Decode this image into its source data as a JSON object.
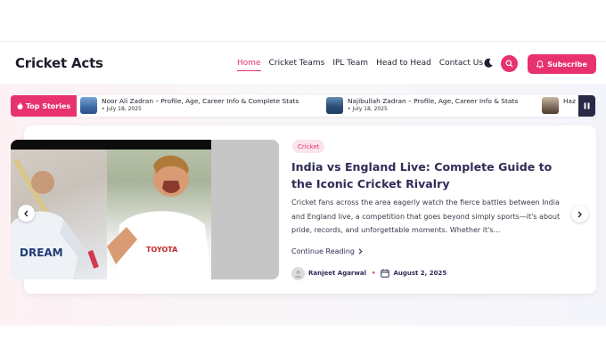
{
  "site": {
    "logo": "Cricket Acts"
  },
  "nav": {
    "items": [
      {
        "label": "Home",
        "active": true
      },
      {
        "label": "Cricket Teams",
        "active": false
      },
      {
        "label": "IPL Team",
        "active": false
      },
      {
        "label": "Head to Head",
        "active": false
      },
      {
        "label": "Contact Us",
        "active": false
      }
    ]
  },
  "header": {
    "theme_icon": "moon-icon",
    "search_icon": "search-icon",
    "subscribe_label": "Subscribe",
    "subscribe_icon": "bell-icon"
  },
  "ticker": {
    "label": "Top Stories",
    "label_icon": "flame-icon",
    "items": [
      {
        "title": "Noor Ali Zadran – Profile, Age, Career Info & Complete Stats",
        "date": "July 18, 2025"
      },
      {
        "title": "Najibullah Zadran – Profile, Age, Career Info & Stats",
        "date": "July 18, 2025"
      },
      {
        "title": "Haz",
        "date": ""
      }
    ],
    "pause_icon": "pause-icon"
  },
  "featured": {
    "category": "Cricket",
    "title": "India vs England Live: Complete Guide to the Iconic Cricket Rivalry",
    "excerpt": "Cricket fans across the area eagerly watch the fierce battles between India and England live, a competition that goes beyond simply sports—it's about pride, records, and unforgettable moments. Whether it's…",
    "continue_label": "Continue Reading",
    "author": "Ranjeet Agarwal",
    "date": "August 2, 2025",
    "photo_labels": {
      "left_text": "DREAM",
      "right_text": "TOYOTA"
    }
  },
  "colors": {
    "accent": "#e8326f",
    "heading": "#2d2d57",
    "pause_bg": "#2a2a48"
  }
}
